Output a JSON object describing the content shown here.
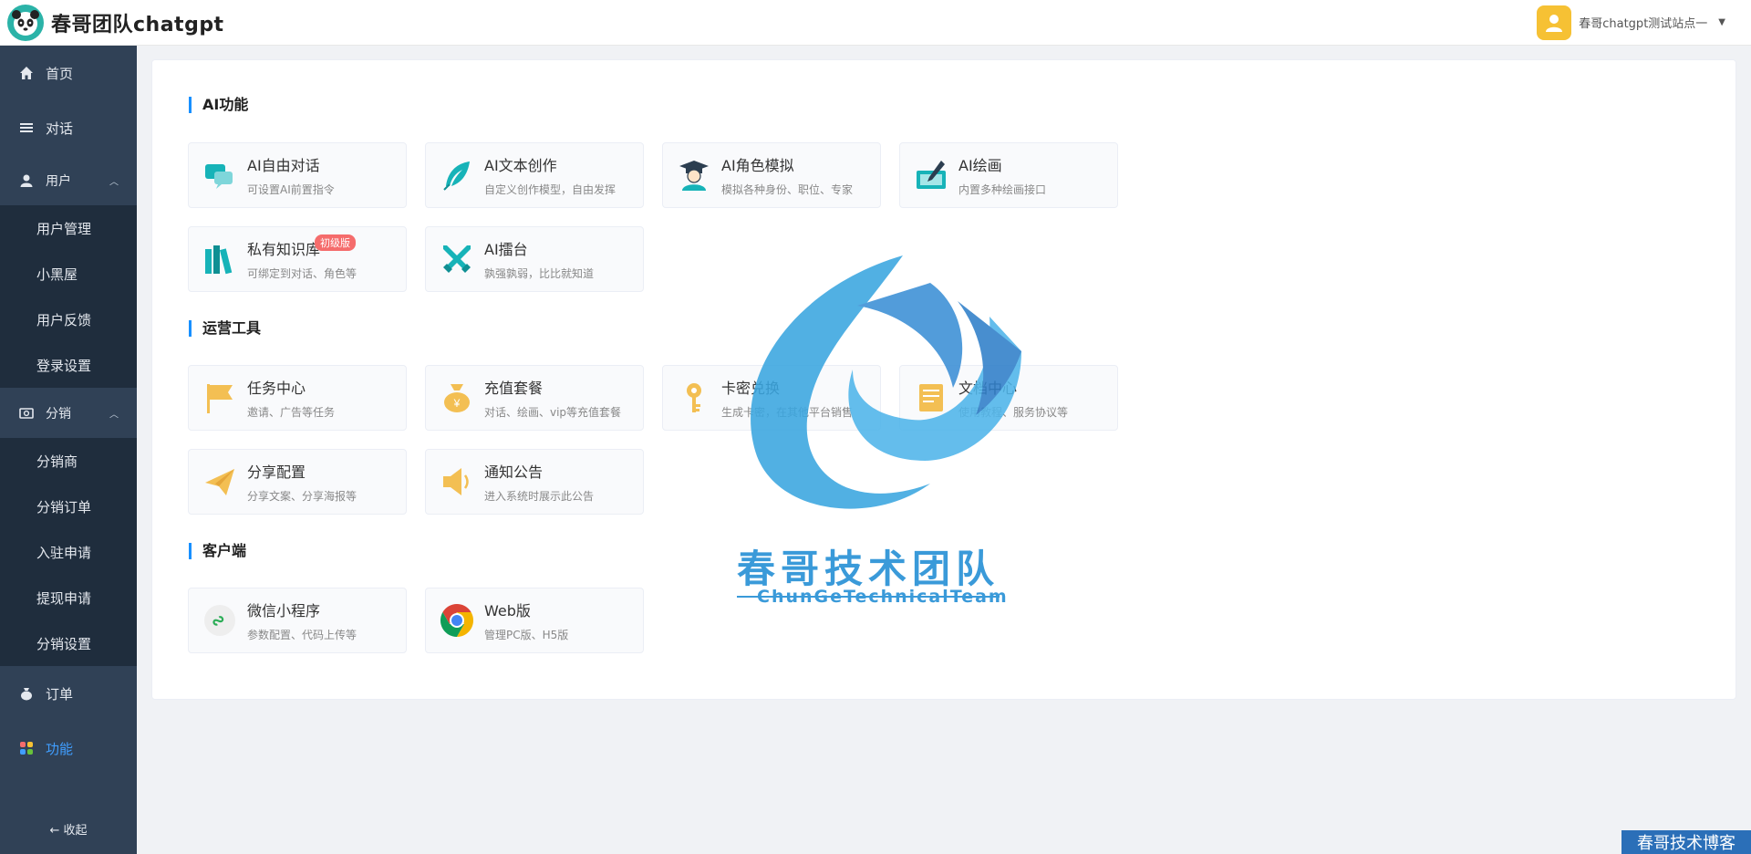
{
  "header": {
    "title": "春哥团队chatgpt",
    "logo_icon": "panda-logo-icon",
    "user_name": "春哥chatgpt测试站点一",
    "user_icon": "user-avatar-icon"
  },
  "sidebar": {
    "home": "首页",
    "chat": "对话",
    "user_group": {
      "label": "用户",
      "items": [
        "用户管理",
        "小黑屋",
        "用户反馈",
        "登录设置"
      ]
    },
    "dist_group": {
      "label": "分销",
      "items": [
        "分销商",
        "分销订单",
        "入驻申请",
        "提现申请",
        "分销设置"
      ]
    },
    "orders": "订单",
    "features": "功能",
    "collapse": "← 收起",
    "active_color": "#409eff"
  },
  "sections": {
    "ai": {
      "title": "AI功能",
      "tiles": [
        {
          "name": "AI自由对话",
          "desc": "可设置AI前置指令",
          "icon": "chat-bubbles-icon"
        },
        {
          "name": "AI文本创作",
          "desc": "自定义创作模型，自由发挥",
          "icon": "feather-pen-icon"
        },
        {
          "name": "AI角色模拟",
          "desc": "模拟各种身份、职位、专家",
          "icon": "graduate-icon"
        },
        {
          "name": "AI绘画",
          "desc": "内置多种绘画接口",
          "icon": "painting-icon"
        },
        {
          "name": "私有知识库",
          "desc": "可绑定到对话、角色等",
          "icon": "books-icon",
          "badge": "初级版"
        },
        {
          "name": "AI擂台",
          "desc": "孰强孰弱，比比就知道",
          "icon": "crossed-swords-icon"
        }
      ]
    },
    "ops": {
      "title": "运营工具",
      "tiles": [
        {
          "name": "任务中心",
          "desc": "邀请、广告等任务",
          "icon": "flag-icon"
        },
        {
          "name": "充值套餐",
          "desc": "对话、绘画、vip等充值套餐",
          "icon": "money-bag-icon"
        },
        {
          "name": "卡密兑换",
          "desc": "生成卡密，在其他平台销售",
          "icon": "key-icon"
        },
        {
          "name": "文档中心",
          "desc": "使用教程、服务协议等",
          "icon": "document-icon"
        },
        {
          "name": "分享配置",
          "desc": "分享文案、分享海报等",
          "icon": "paper-plane-icon"
        },
        {
          "name": "通知公告",
          "desc": "进入系统时展示此公告",
          "icon": "speaker-icon"
        }
      ]
    },
    "client": {
      "title": "客户端",
      "tiles": [
        {
          "name": "微信小程序",
          "desc": "参数配置、代码上传等",
          "icon": "mini-program-icon"
        },
        {
          "name": "Web版",
          "desc": "管理PC版、H5版",
          "icon": "chrome-icon"
        }
      ]
    }
  },
  "watermark": {
    "title": "春哥技术团队",
    "subtitle": "ChunGeTechnicalTeam",
    "corner": "春哥技术博客"
  }
}
